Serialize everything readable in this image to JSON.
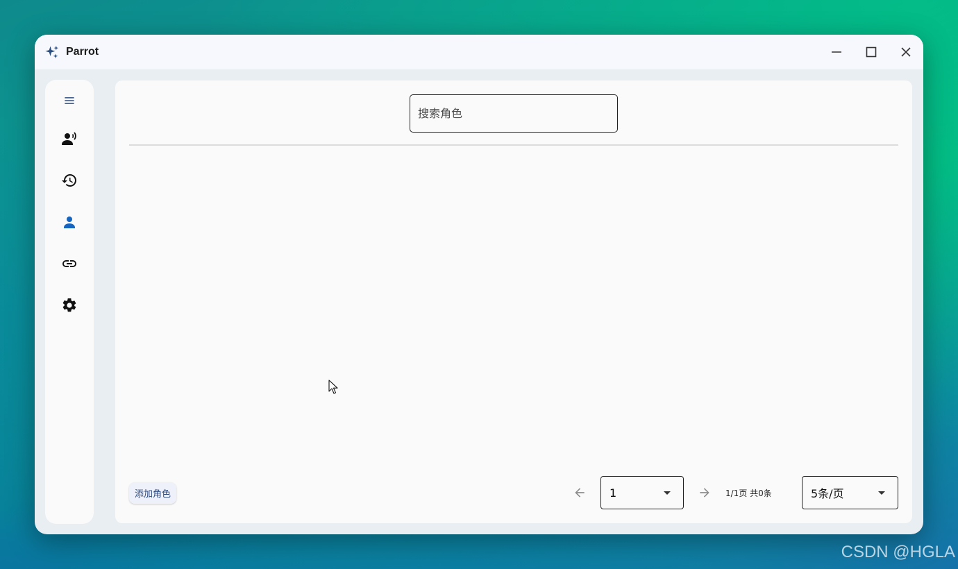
{
  "window": {
    "title": "Parrot",
    "app_icon": "sparkle-icon",
    "controls": [
      "minimize-icon",
      "maximize-icon",
      "close-icon"
    ]
  },
  "sidebar": {
    "items": [
      {
        "icon": "menu-icon",
        "active": false
      },
      {
        "icon": "voice-person-icon",
        "active": false
      },
      {
        "icon": "history-icon",
        "active": false
      },
      {
        "icon": "person-icon",
        "active": true
      },
      {
        "icon": "link-icon",
        "active": false
      },
      {
        "icon": "gear-icon",
        "active": false
      }
    ],
    "accent_color": "#1565c0"
  },
  "search": {
    "placeholder": "搜索角色",
    "value": ""
  },
  "footer": {
    "add_button_label": "添加角色",
    "page_select_value": "1",
    "page_info": "1/1页 共0条",
    "page_size_value": "5条/页"
  },
  "watermark": "CSDN @HGLA"
}
